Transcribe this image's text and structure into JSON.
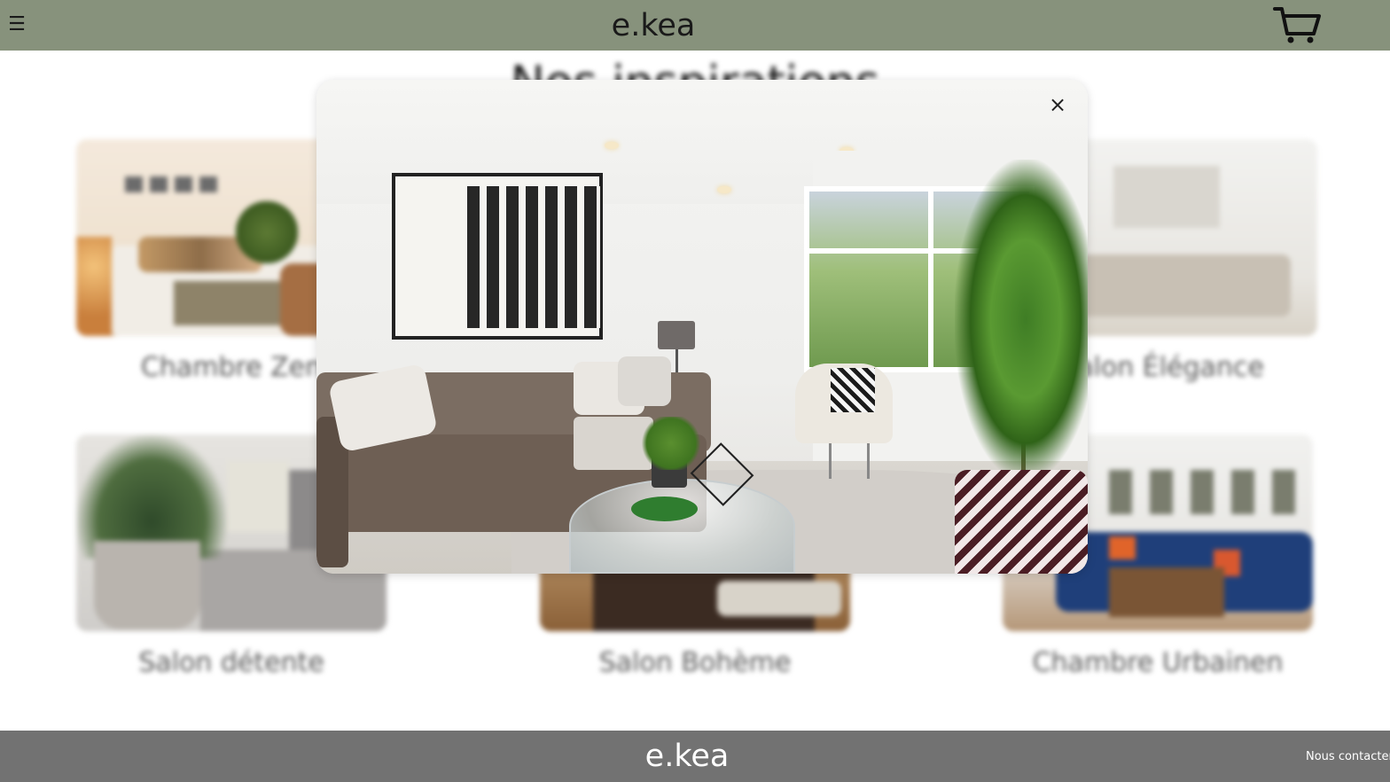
{
  "header": {
    "brand": "e.kea",
    "menu_icon": "hamburger-menu-icon",
    "cart_icon": "shopping-cart-icon",
    "menu_glyph": "☰"
  },
  "page": {
    "section_title": "Nos inspirations",
    "cards": [
      {
        "label": "Chambre Zen"
      },
      {
        "label": "Salon Élégance"
      },
      {
        "label": "Salon détente"
      },
      {
        "label": "Salon Bohème"
      },
      {
        "label": "Chambre Urbainen"
      }
    ]
  },
  "modal": {
    "close_glyph": "×",
    "close_icon": "close-icon"
  },
  "footer": {
    "brand": "e.kea",
    "contact_label": "Nous contacter"
  },
  "colors": {
    "header_bg": "#87927c",
    "footer_bg": "#727272"
  }
}
